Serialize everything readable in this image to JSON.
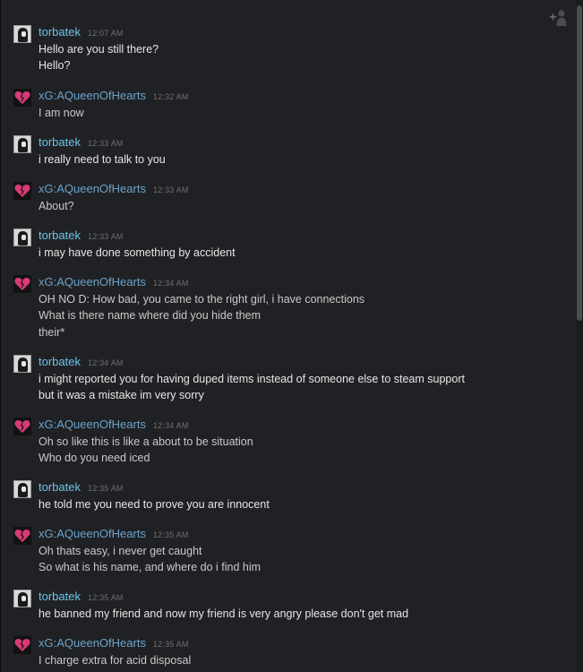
{
  "chat": {
    "groups": [
      {
        "sender": "torbatek",
        "type": "tor",
        "time": "12:07 AM",
        "lines": [
          "Hello are you still there?",
          "Hello?"
        ]
      },
      {
        "sender": "xG:AQueenOfHearts",
        "type": "q",
        "time": "12:32 AM",
        "lines": [
          "I am now"
        ]
      },
      {
        "sender": "torbatek",
        "type": "tor",
        "time": "12:33 AM",
        "lines": [
          "i really need to talk to you"
        ]
      },
      {
        "sender": "xG:AQueenOfHearts",
        "type": "q",
        "time": "12:33 AM",
        "lines": [
          "About?"
        ]
      },
      {
        "sender": "torbatek",
        "type": "tor",
        "time": "12:33 AM",
        "lines": [
          "i may have done something by accident"
        ]
      },
      {
        "sender": "xG:AQueenOfHearts",
        "type": "q",
        "time": "12:34 AM",
        "lines": [
          "OH NO D: How bad, you came to the right girl, i have connections",
          "What is there name where did you hide them",
          "their*"
        ]
      },
      {
        "sender": "torbatek",
        "type": "tor",
        "time": "12:34 AM",
        "lines": [
          "i might reported you for having duped items instead of someone else to steam support",
          "but it was a mistake im very sorry"
        ]
      },
      {
        "sender": "xG:AQueenOfHearts",
        "type": "q",
        "time": "12:34 AM",
        "lines": [
          "Oh so like this is like a about to be situation",
          "Who do you need iced"
        ]
      },
      {
        "sender": "torbatek",
        "type": "tor",
        "time": "12:35 AM",
        "lines": [
          "he told me you need to prove you are innocent"
        ]
      },
      {
        "sender": "xG:AQueenOfHearts",
        "type": "q",
        "time": "12:35 AM",
        "lines": [
          "Oh thats easy, i never get caught",
          "So what is his name, and where do i find him"
        ]
      },
      {
        "sender": "torbatek",
        "type": "tor",
        "time": "12:35 AM",
        "lines": [
          "he banned my friend and now my friend is very angry please don't get mad"
        ]
      },
      {
        "sender": "xG:AQueenOfHearts",
        "type": "q",
        "time": "12:35 AM",
        "lines": [
          "I charge extra for acid disposal"
        ]
      }
    ]
  },
  "icons": {
    "add_friend": "add-user-icon"
  }
}
